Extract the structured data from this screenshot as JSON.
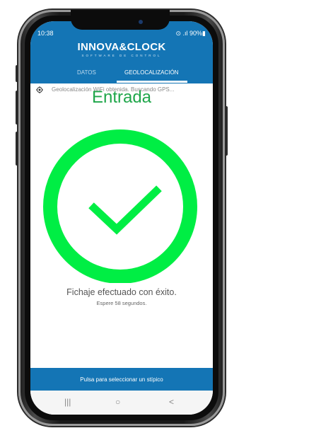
{
  "status_bar": {
    "time": "10:38",
    "signal": "⊙ .ıl 90%▮"
  },
  "app": {
    "brand": "INNOVA&CLOCK",
    "brand_sub": "SOFTWARE DE CONTROL",
    "tabs": [
      {
        "label": "DATOS"
      },
      {
        "label": "GEOLOCALIZACIÓN"
      }
    ],
    "active_tab": "GEOLOCALIZACIÓN"
  },
  "geo": {
    "status": "Geolocalización WiFi obtenida. Buscando GPS..."
  },
  "overlay_label": "Entrada",
  "result": {
    "message": "Fichaje efectuado con éxito.",
    "countdown": "Espere 58 segundos."
  },
  "bottom": {
    "label": "Pulsa para seleccionar un stípico"
  },
  "nav": {
    "recent": "|||",
    "home": "○",
    "back": "<"
  },
  "colors": {
    "accent": "#1475b5",
    "success": "#00ee44",
    "entrada": "#1fa64a"
  }
}
